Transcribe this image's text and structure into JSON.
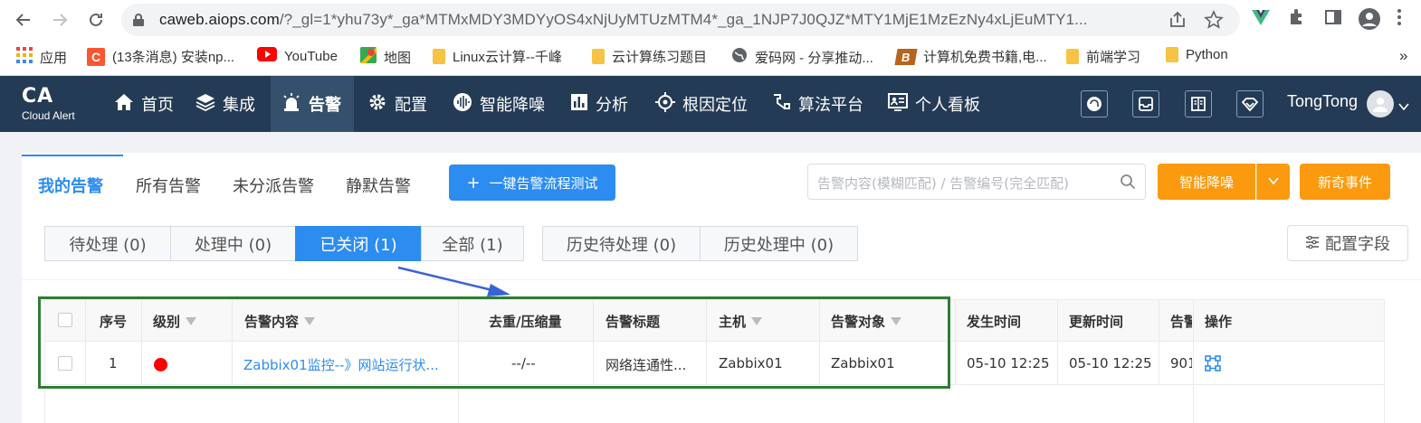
{
  "browser": {
    "url_main": "caweb.aiops.com",
    "url_rest": "/?_gl=1*yhu73y*_ga*MTMxMDY3MDYyOS4xNjUyMTUzMTM4*_ga_1NJP7J0QJZ*MTY1MjE1MzEzNy4xLjEuMTY1...",
    "bookmarks": [
      {
        "label": "应用"
      },
      {
        "label": "(13条消息) 安装np..."
      },
      {
        "label": "YouTube"
      },
      {
        "label": "地图"
      },
      {
        "label": "Linux云计算--千峰"
      },
      {
        "label": "云计算练习题目"
      },
      {
        "label": "爱码网 - 分享推动..."
      },
      {
        "label": "计算机免费书籍,电..."
      },
      {
        "label": "前端学习"
      },
      {
        "label": "Python"
      }
    ],
    "more": "»"
  },
  "app": {
    "logo_main": "CA",
    "logo_sub": "Cloud Alert",
    "nav": [
      {
        "label": "首页",
        "icon": "home-icon"
      },
      {
        "label": "集成",
        "icon": "layers-icon"
      },
      {
        "label": "告警",
        "icon": "alarm-icon"
      },
      {
        "label": "配置",
        "icon": "gear-icon"
      },
      {
        "label": "智能降噪",
        "icon": "noise-icon"
      },
      {
        "label": "分析",
        "icon": "bar-chart-icon"
      },
      {
        "label": "根因定位",
        "icon": "target-icon"
      },
      {
        "label": "算法平台",
        "icon": "algorithm-icon"
      },
      {
        "label": "个人看板",
        "icon": "dashboard-icon"
      }
    ],
    "user": "TongTong"
  },
  "toolbar": {
    "tabs": [
      "我的告警",
      "所有告警",
      "未分派告警",
      "静默告警"
    ],
    "test_button": "一键告警流程测试",
    "search_placeholder": "告警内容(模糊匹配) / 告警编号(完全匹配)",
    "noise_button": "智能降噪",
    "new_event_button": "新奇事件"
  },
  "status_tabs": [
    "待处理 (0)",
    "处理中 (0)",
    "已关闭 (1)",
    "全部 (1)",
    "历史待处理 (0)",
    "历史处理中 (0)"
  ],
  "config_fields": "配置字段",
  "table": {
    "columns": [
      "序号",
      "级别",
      "告警内容",
      "去重/压缩量",
      "告警标题",
      "主机",
      "告警对象",
      "发生时间",
      "更新时间",
      "告警",
      "操作"
    ],
    "rows": [
      {
        "index": "1",
        "level_color": "#ff0000",
        "content": "Zabbix01监控--》网站运行状...",
        "dedup": "--/--",
        "title": "网络连通性...",
        "host": "Zabbix01",
        "object": "Zabbix01",
        "occurred": "05-10 12:25",
        "updated": "05-10 12:25",
        "extra": "901"
      }
    ]
  },
  "colors": {
    "nav_bg": "#243b55",
    "primary": "#2d8cf0",
    "orange": "#fb9a0e",
    "highlight_box": "#2e7d32",
    "arrow": "#3a62d8"
  }
}
